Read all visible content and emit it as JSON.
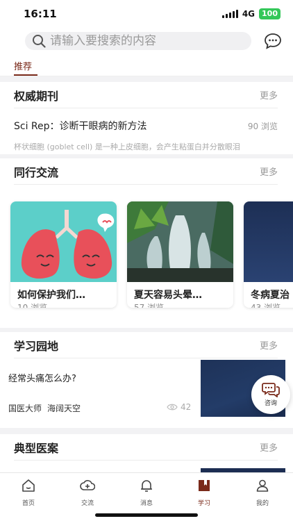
{
  "status": {
    "time": "16:11",
    "network": "4G",
    "battery": "100"
  },
  "search": {
    "placeholder": "请输入要搜索的内容"
  },
  "tabs": [
    {
      "label": "推荐",
      "active": true
    }
  ],
  "journals": {
    "title": "权威期刊",
    "more": "更多",
    "item": {
      "title": "Sci Rep：诊断干眼病的新方法",
      "views": "90 浏览",
      "desc": "杯状细胞 (goblet cell) 是一种上皮细胞，会产生粘蛋白并分散眼泪"
    }
  },
  "peers": {
    "title": "同行交流",
    "more": "更多",
    "cards": [
      {
        "title": "如何保护我们…",
        "views": "10 浏览",
        "image": "lungs-illustration"
      },
      {
        "title": "夏天容易头晕…",
        "views": "57 浏览",
        "image": "fountain-photo"
      },
      {
        "title": "冬病夏治",
        "views": "43 浏览",
        "image": "night-sky-photo"
      }
    ]
  },
  "study": {
    "title": "学习园地",
    "more": "更多",
    "item": {
      "question": "经常头痛怎么办?",
      "author1": "国医大师",
      "author2": "海阔天空",
      "views": "42"
    }
  },
  "cases": {
    "title": "典型医案",
    "more": "更多"
  },
  "consult": {
    "label": "咨询"
  },
  "tabbar": [
    {
      "label": "首页",
      "icon": "home-icon"
    },
    {
      "label": "交流",
      "icon": "cloud-plus-icon"
    },
    {
      "label": "消息",
      "icon": "bell-icon"
    },
    {
      "label": "学习",
      "icon": "book-icon",
      "active": true
    },
    {
      "label": "我的",
      "icon": "user-icon"
    }
  ],
  "colors": {
    "accent": "#7a2a1a",
    "battery": "#34c759"
  }
}
